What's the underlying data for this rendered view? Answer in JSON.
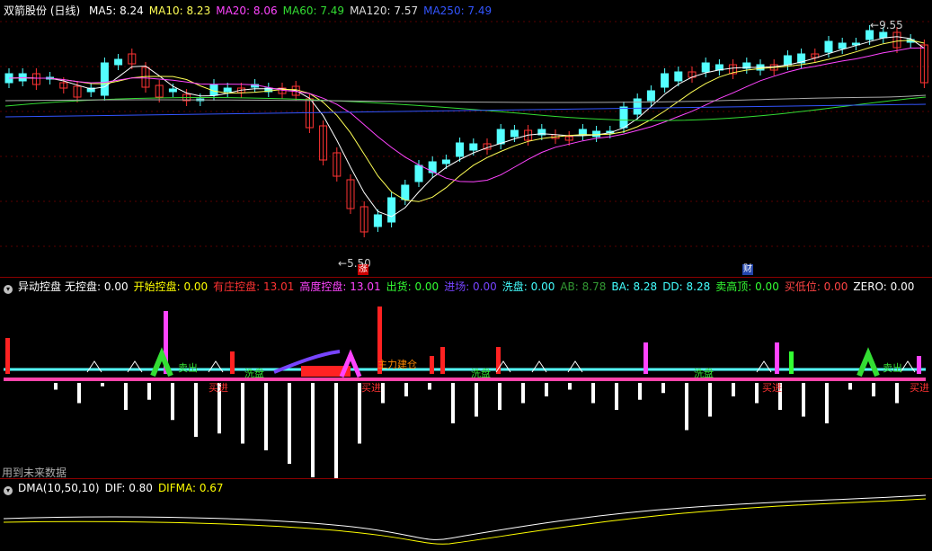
{
  "main": {
    "title": "双箭股份 (日线)",
    "ma_items": [
      {
        "label": "MA5: 8.24",
        "color": "#ffffff"
      },
      {
        "label": "MA10: 8.23",
        "color": "#ffff55"
      },
      {
        "label": "MA20: 8.06",
        "color": "#ff44ff"
      },
      {
        "label": "MA60: 7.49",
        "color": "#33dd33"
      },
      {
        "label": "MA120: 7.57",
        "color": "#dddddd"
      },
      {
        "label": "MA250: 7.49",
        "color": "#3355ff"
      }
    ],
    "high_label": "9.55",
    "low_label": "5.50",
    "marker_zhang": "涨",
    "marker_cai": "财"
  },
  "indicator": {
    "title": "异动控盘",
    "items": [
      {
        "label": "无控盘: 0.00",
        "color": "#ffffff"
      },
      {
        "label": "开始控盘: 0.00",
        "color": "#ffff00"
      },
      {
        "label": "有庄控盘: 13.01",
        "color": "#ff3333"
      },
      {
        "label": "高度控盘: 13.01",
        "color": "#ff44ff"
      },
      {
        "label": "出货: 0.00",
        "color": "#33ff33"
      },
      {
        "label": "进场: 0.00",
        "color": "#7744ff"
      },
      {
        "label": "洗盘: 0.00",
        "color": "#44ffff"
      },
      {
        "label": "AB: 8.78",
        "color": "#339933"
      },
      {
        "label": "BA: 8.28",
        "color": "#44ffff"
      },
      {
        "label": "DD: 8.28",
        "color": "#44ffff"
      },
      {
        "label": "卖高顶: 0.00",
        "color": "#33ff33"
      },
      {
        "label": "买低位: 0.00",
        "color": "#ff4444"
      },
      {
        "label": "ZERO: 0.00",
        "color": "#ffffff"
      }
    ],
    "labels": {
      "sell": "卖出",
      "wash": "洗盘",
      "buy": "买进",
      "chase": "追涨",
      "ma": "主力建仓"
    },
    "footer": "用到未来数据"
  },
  "dma": {
    "title": "DMA(10,50,10)",
    "items": [
      {
        "label": "DIF: 0.80",
        "color": "#ffffff"
      },
      {
        "label": "DIFMA: 0.67",
        "color": "#ffff00"
      }
    ]
  },
  "colors": {
    "up": "#ff3333",
    "down": "#54ffff",
    "grid": "#8b0000"
  }
}
